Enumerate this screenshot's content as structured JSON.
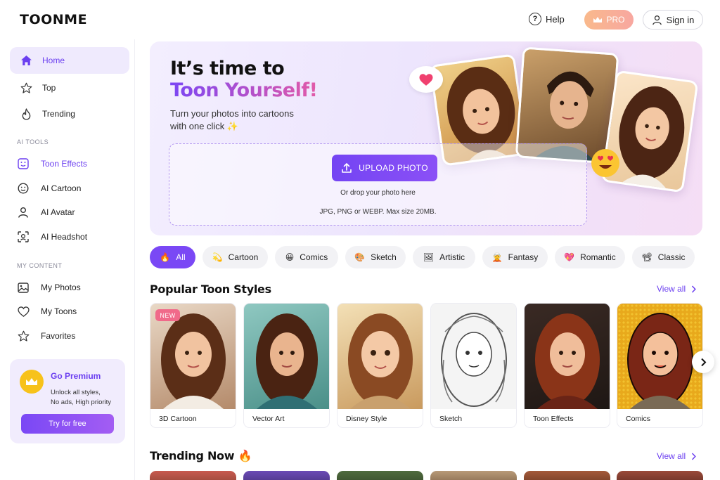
{
  "header": {
    "logo": "TOONME",
    "help_label": "Help",
    "pro_label": "PRO",
    "signin_label": "Sign in"
  },
  "sidebar": {
    "nav": [
      {
        "label": "Home",
        "icon": "home-icon",
        "active": true
      },
      {
        "label": "Top",
        "icon": "star-icon"
      },
      {
        "label": "Trending",
        "icon": "flame-icon"
      }
    ],
    "ai_tools_label": "AI TOOLS",
    "ai_tools": [
      {
        "label": "Toon Effects",
        "icon": "toon-face-icon"
      },
      {
        "label": "AI Cartoon",
        "icon": "smile-icon"
      },
      {
        "label": "AI Avatar",
        "icon": "user-icon"
      },
      {
        "label": "AI Headshot",
        "icon": "face-scan-icon"
      }
    ],
    "my_content_label": "MY CONTENT",
    "my_content": [
      {
        "label": "My Photos",
        "icon": "image-icon"
      },
      {
        "label": "My Toons",
        "icon": "heart-icon"
      },
      {
        "label": "Favorites",
        "icon": "star-icon"
      }
    ],
    "premium": {
      "title": "Go Premium",
      "desc_line1": "Unlock all styles,",
      "desc_line2": "No ads, High priority",
      "button": "Try for free"
    }
  },
  "hero": {
    "title_line1": "It’s time to",
    "title_line2": "Toon Yourself!",
    "subtitle_line1": "Turn your photos into cartoons",
    "subtitle_line2": "with one click ✨",
    "upload_label": "UPLOAD PHOTO",
    "drop_hint": "Or drop your photo here",
    "formats": "JPG, PNG or WEBP. Max size 20MB."
  },
  "filters": [
    {
      "label": "All",
      "emoji": "🔥",
      "active": true
    },
    {
      "label": "Cartoon",
      "emoji": "💫"
    },
    {
      "label": "Comics",
      "emoji": "😀"
    },
    {
      "label": "Sketch",
      "emoji": "🎨"
    },
    {
      "label": "Artistic",
      "emoji": "🖼"
    },
    {
      "label": "Fantasy",
      "emoji": "🧝"
    },
    {
      "label": "Romantic",
      "emoji": "💖"
    },
    {
      "label": "Classic",
      "emoji": "📽"
    }
  ],
  "popular": {
    "title": "Popular Toon Styles",
    "view_all": "View all",
    "new_badge": "NEW",
    "styles": [
      "3D Cartoon",
      "Vector Art",
      "Disney Style",
      "Sketch",
      "Toon Effects",
      "Comics"
    ]
  },
  "trending": {
    "title": "Trending Now 🔥",
    "view_all": "View all"
  },
  "colors": {
    "accent": "#7a48f5",
    "accent_text": "#6b3ff0",
    "badge_new": "#f06a8a",
    "premium_bg": "#f1ecfd",
    "crown": "#f7c21b"
  }
}
